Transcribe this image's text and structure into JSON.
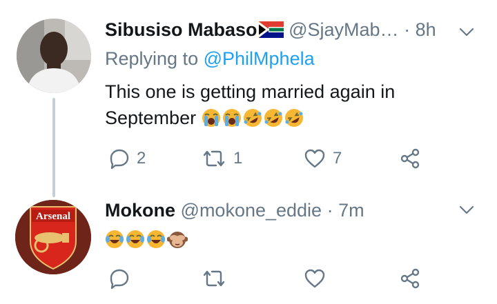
{
  "tweets": [
    {
      "name": "Sibusiso Mabaso",
      "flag": "south-africa-flag-emoji",
      "handle": "@SjayMab…",
      "separator": "·",
      "time": "8h",
      "replying_label": "Replying to",
      "replying_to": "@PhilMphela",
      "text_line1": "This one is getting married again in",
      "text_line2": "September",
      "emojis": [
        "loudly-crying-face",
        "loudly-crying-face",
        "rolling-on-floor-laughing",
        "rolling-on-floor-laughing",
        "rolling-on-floor-laughing"
      ],
      "reply_count": "2",
      "retweet_count": "1",
      "like_count": "7"
    },
    {
      "name": "Mokone",
      "handle": "@mokone_eddie",
      "separator": "·",
      "time": "7m",
      "emojis": [
        "face-with-tears-of-joy",
        "face-with-tears-of-joy",
        "face-with-tears-of-joy",
        "see-no-evil-monkey"
      ],
      "avatar_text": "Arsenal"
    }
  ],
  "colors": {
    "text": "#14171a",
    "secondary": "#657786",
    "link": "#1da1f2",
    "thread_line": "#c4cfd6"
  }
}
